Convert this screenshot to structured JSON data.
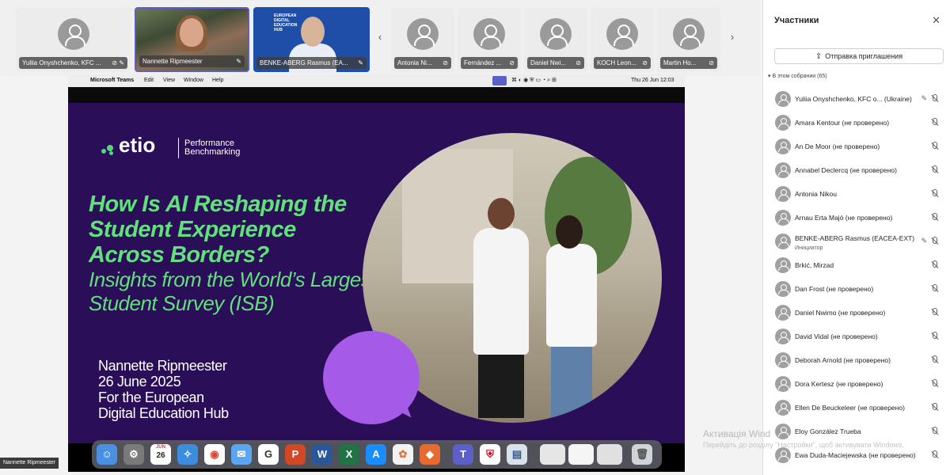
{
  "strip": {
    "tiles": [
      {
        "name": "Yuliia Onyshchenko, KFC ...",
        "type": "avatar"
      },
      {
        "name": "Nannette Ripmeester",
        "type": "video"
      },
      {
        "name": "BENKE-ABERG Rasmus (EA...",
        "type": "video"
      },
      {
        "name": "Antonia Ni...",
        "type": "avatar"
      },
      {
        "name": "Fernández ...",
        "type": "avatar"
      },
      {
        "name": "Daniel Nwi...",
        "type": "avatar"
      },
      {
        "name": "KOCH Leon...",
        "type": "avatar"
      },
      {
        "name": "Martin Ho...",
        "type": "avatar"
      }
    ],
    "tile2_logo": "EUROPEAN DIGITAL EDUCATION HUB",
    "prev_arrow": "‹",
    "next_arrow": "›"
  },
  "macbar": {
    "apple": "",
    "app": "Microsoft Teams",
    "menus": [
      "Edit",
      "View",
      "Window",
      "Help"
    ],
    "clock": "Thu 26 Jun  12:03"
  },
  "slide": {
    "logo": "etio",
    "logo_sub_1": "Performance",
    "logo_sub_2": "Benchmarking",
    "headline": "How Is AI Reshaping the Student Experience Across Borders?",
    "subheadline": "Insights from the World’s Largest Student Survey (ISB)",
    "presenter_name": "Nannette Ripmeester",
    "date": "26 June 2025",
    "for_line_1": "For the European",
    "for_line_2": "Digital Education Hub",
    "colors": {
      "background": "#2a0f58",
      "accent_green": "#61e07b",
      "bubble": "#a55be8"
    }
  },
  "dock": {
    "icons": [
      "finder-icon",
      "settings-icon",
      "calendar-icon",
      "safari-icon",
      "chrome-icon",
      "mail-icon",
      "google-icon",
      "powerpoint-icon",
      "word-icon",
      "excel-icon",
      "appstore-icon",
      "photos-icon",
      "vpn-icon",
      "teams-icon",
      "shield-icon",
      "preview-icon",
      "window1-icon",
      "window2-icon",
      "window3-icon",
      "trash-icon"
    ],
    "calendar_month": "JUN",
    "calendar_day": "26"
  },
  "presenter_tag": "Nannette Ripmeester",
  "panel": {
    "title": "Участники",
    "close": "✕",
    "invite_label": "Отправка приглашения",
    "meeting_header": "▾ В этом собрании (65)",
    "participants": [
      {
        "name": "Yuliia Onyshchenko, KFC o... (Ukraine)",
        "pinned": true
      },
      {
        "name": "Amara Kentour (не проверено)"
      },
      {
        "name": "An De Moor (не проверено)"
      },
      {
        "name": "Annabel Declercq (не проверено)"
      },
      {
        "name": "Antonia Nikou"
      },
      {
        "name": "Arnau Erta Majó (не проверено)"
      },
      {
        "name": "BENKE-ABERG Rasmus (EACEA-EXT)",
        "role": "Инициатор",
        "pinned": true
      },
      {
        "name": "Brkić, Mirzad"
      },
      {
        "name": "Dan Frost (не проверено)"
      },
      {
        "name": "Daniel Nwimo (не проверено)"
      },
      {
        "name": "David Vidal (не проверено)"
      },
      {
        "name": "Deborah Arnold (не проверено)"
      },
      {
        "name": "Dora Kertesz (не проверено)"
      },
      {
        "name": "Ellen De Beuckeleer (не проверено)"
      },
      {
        "name": "Eloy González Trueba"
      },
      {
        "name": "Ewa Duda-Maciejewska (не проверено)"
      }
    ]
  },
  "watermark": {
    "line1": "Активація Wind",
    "line2": "Перейдіть до розділу \"Настройки\", щоб активувати Windows."
  }
}
